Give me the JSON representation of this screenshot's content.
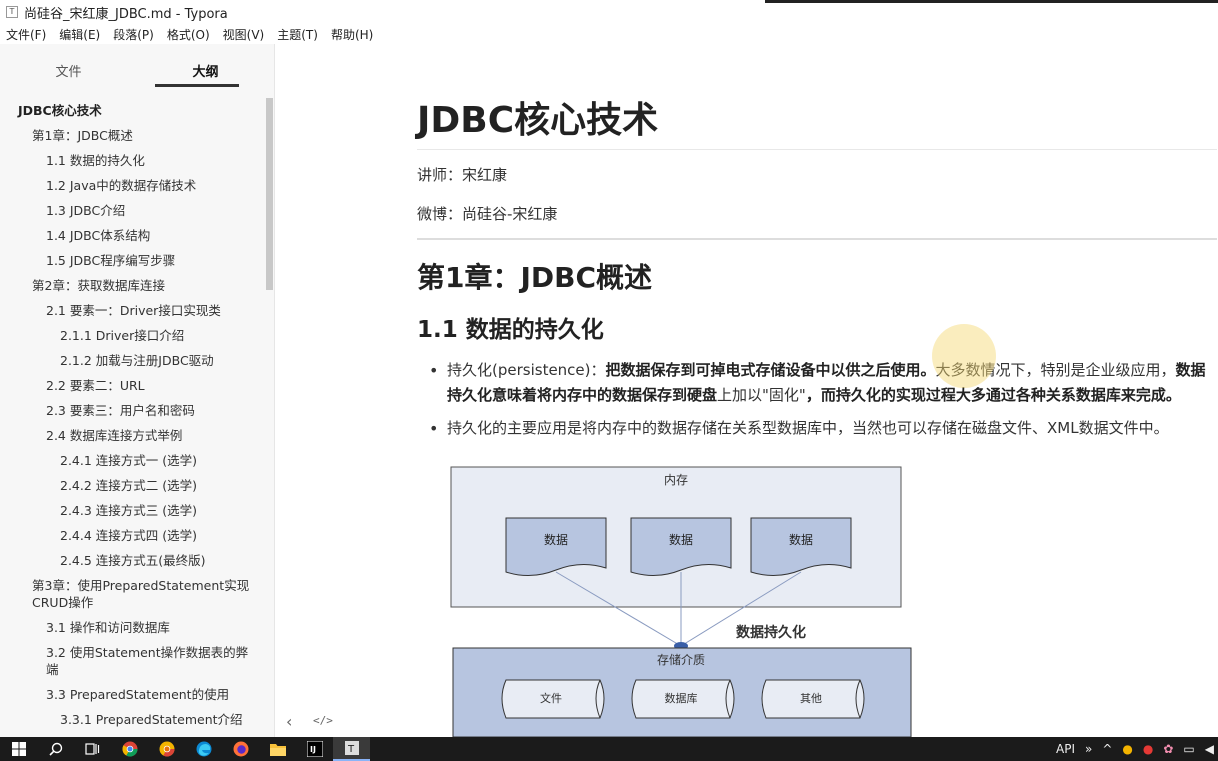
{
  "window": {
    "title": "尚硅谷_宋红康_JDBC.md - Typora"
  },
  "menu": [
    "文件(F)",
    "编辑(E)",
    "段落(P)",
    "格式(O)",
    "视图(V)",
    "主题(T)",
    "帮助(H)"
  ],
  "sidebar": {
    "tabs": {
      "files": "文件",
      "outline": "大纲"
    },
    "active_tab": "大纲",
    "outline": [
      {
        "label": "JDBC核心技术",
        "level": 1
      },
      {
        "label": "第1章：JDBC概述",
        "level": 2
      },
      {
        "label": "1.1 数据的持久化",
        "level": 3
      },
      {
        "label": "1.2 Java中的数据存储技术",
        "level": 3
      },
      {
        "label": "1.3 JDBC介绍",
        "level": 3
      },
      {
        "label": "1.4 JDBC体系结构",
        "level": 3
      },
      {
        "label": "1.5 JDBC程序编写步骤",
        "level": 3
      },
      {
        "label": "第2章：获取数据库连接",
        "level": 2
      },
      {
        "label": "2.1 要素一：Driver接口实现类",
        "level": 3
      },
      {
        "label": "2.1.1 Driver接口介绍",
        "level": 4
      },
      {
        "label": "2.1.2 加载与注册JDBC驱动",
        "level": 4
      },
      {
        "label": "2.2 要素二：URL",
        "level": 3
      },
      {
        "label": "2.3 要素三：用户名和密码",
        "level": 3
      },
      {
        "label": "2.4 数据库连接方式举例",
        "level": 3
      },
      {
        "label": "2.4.1 连接方式一 (选学)",
        "level": 4
      },
      {
        "label": "2.4.2 连接方式二 (选学)",
        "level": 4
      },
      {
        "label": "2.4.3 连接方式三 (选学)",
        "level": 4
      },
      {
        "label": "2.4.4 连接方式四 (选学)",
        "level": 4
      },
      {
        "label": "2.4.5 连接方式五(最终版)",
        "level": 4
      },
      {
        "label": "第3章：使用PreparedStatement实现CRUD操作",
        "level": 2,
        "wrap": true
      },
      {
        "label": "3.1 操作和访问数据库",
        "level": 3
      },
      {
        "label": "3.2 使用Statement操作数据表的弊端",
        "level": 3,
        "wrap": true
      },
      {
        "label": "3.3 PreparedStatement的使用",
        "level": 3
      },
      {
        "label": "3.3.1 PreparedStatement介绍",
        "level": 4
      }
    ],
    "footer": {
      "back": "‹",
      "source": "</>"
    }
  },
  "doc": {
    "h1": "JDBC核心技术",
    "lecturer": "讲师：宋红康",
    "weibo": "微博：尚硅谷-宋红康",
    "h2": "第1章：JDBC概述",
    "h3": "1.1 数据的持久化",
    "bullet1": {
      "a": "持久化(persistence)：",
      "b": "把数据保存到可掉电式存储设备中以供之后使用。",
      "c": "大多数情况下，特别是企业级应用，",
      "d": "数据持久化意味着将内存中的数据保存到硬盘",
      "e": "上加以\"固化\"",
      "f": "，而持久化的实现过程大多通过各种关系数据库来完成。"
    },
    "bullet2": "持久化的主要应用是将内存中的数据存储在关系型数据库中，当然也可以存储在磁盘文件、XML数据文件中。"
  },
  "diagram": {
    "memory_label": "内存",
    "data_labels": [
      "数据",
      "数据",
      "数据"
    ],
    "persist_label": "数据持久化",
    "storage_label": "存储介质",
    "storage_items": [
      "文件",
      "数据库",
      "其他"
    ]
  },
  "taskbar": {
    "tray_text": "API"
  }
}
